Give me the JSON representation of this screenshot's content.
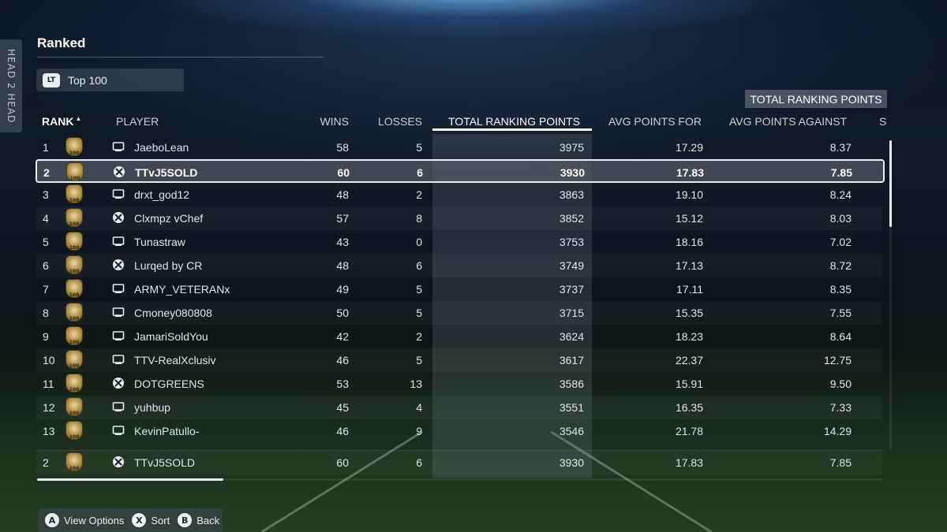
{
  "side_tab": {
    "label": "HEAD 2 HEAD"
  },
  "page": {
    "title": "Ranked"
  },
  "filter": {
    "badge": "LT",
    "label": "Top 100"
  },
  "sort_chip": {
    "label": "TOTAL RANKING POINTS"
  },
  "columns": {
    "rank": "RANK",
    "player": "PLAYER",
    "wins": "WINS",
    "losses": "LOSSES",
    "trp": "TOTAL RANKING POINTS",
    "pf": "AVG POINTS FOR",
    "pa": "AVG POINTS AGAINST",
    "more": "S"
  },
  "rank_badge_text": "100",
  "rows": [
    {
      "rank": "1",
      "platform": "console",
      "name": "JaeboLean",
      "wins": "58",
      "losses": "5",
      "trp": "3975",
      "pf": "17.29",
      "pa": "8.37"
    },
    {
      "rank": "2",
      "platform": "xbox",
      "name": "TTvJ5SOLD",
      "wins": "60",
      "losses": "6",
      "trp": "3930",
      "pf": "17.83",
      "pa": "7.85",
      "selected": true
    },
    {
      "rank": "3",
      "platform": "console",
      "name": "drxt_god12",
      "wins": "48",
      "losses": "2",
      "trp": "3863",
      "pf": "19.10",
      "pa": "8.24"
    },
    {
      "rank": "4",
      "platform": "xbox",
      "name": "Clxmpz vChef",
      "wins": "57",
      "losses": "8",
      "trp": "3852",
      "pf": "15.12",
      "pa": "8.03"
    },
    {
      "rank": "5",
      "platform": "console",
      "name": "Tunastraw",
      "wins": "43",
      "losses": "0",
      "trp": "3753",
      "pf": "18.16",
      "pa": "7.02"
    },
    {
      "rank": "6",
      "platform": "xbox",
      "name": "Lurqed by CR",
      "wins": "48",
      "losses": "6",
      "trp": "3749",
      "pf": "17.13",
      "pa": "8.72"
    },
    {
      "rank": "7",
      "platform": "console",
      "name": "ARMY_VETERANx",
      "wins": "49",
      "losses": "5",
      "trp": "3737",
      "pf": "17.11",
      "pa": "8.35"
    },
    {
      "rank": "8",
      "platform": "console",
      "name": "Cmoney080808",
      "wins": "50",
      "losses": "5",
      "trp": "3715",
      "pf": "15.35",
      "pa": "7.55"
    },
    {
      "rank": "9",
      "platform": "console",
      "name": "JamariSoldYou",
      "wins": "42",
      "losses": "2",
      "trp": "3624",
      "pf": "18.23",
      "pa": "8.64"
    },
    {
      "rank": "10",
      "platform": "console",
      "name": "TTV-RealXclusiv",
      "wins": "46",
      "losses": "5",
      "trp": "3617",
      "pf": "22.37",
      "pa": "12.75"
    },
    {
      "rank": "11",
      "platform": "xbox",
      "name": "DOTGREENS",
      "wins": "53",
      "losses": "13",
      "trp": "3586",
      "pf": "15.91",
      "pa": "9.50"
    },
    {
      "rank": "12",
      "platform": "console",
      "name": "yuhbup",
      "wins": "45",
      "losses": "4",
      "trp": "3551",
      "pf": "16.35",
      "pa": "7.33"
    },
    {
      "rank": "13",
      "platform": "console",
      "name": "KevinPatullo-",
      "wins": "46",
      "losses": "9",
      "trp": "3546",
      "pf": "21.78",
      "pa": "14.29"
    }
  ],
  "my_row": {
    "rank": "2",
    "platform": "xbox",
    "name": "TTvJ5SOLD",
    "wins": "60",
    "losses": "6",
    "trp": "3930",
    "pf": "17.83",
    "pa": "7.85"
  },
  "hints": [
    {
      "button": "A",
      "label": "View Options"
    },
    {
      "button": "X",
      "label": "Sort"
    },
    {
      "button": "B",
      "label": "Back"
    }
  ],
  "scroll": {
    "vertical_fraction_visible": 0.28,
    "horizontal_fraction_visible": 0.22
  }
}
